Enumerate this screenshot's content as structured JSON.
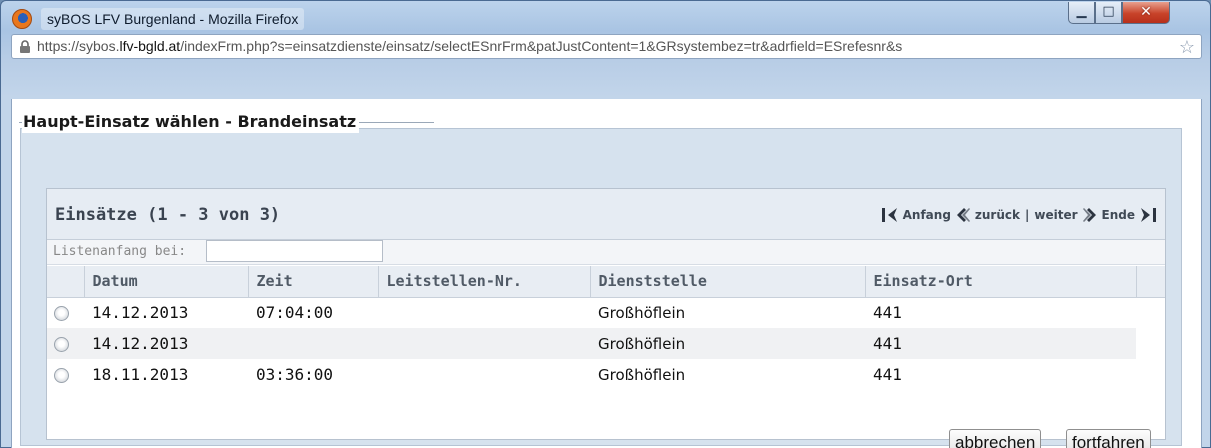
{
  "window": {
    "title": "syBOS LFV Burgenland - Mozilla Firefox",
    "controls": {
      "minimize": "▁",
      "maximize": "□",
      "close": "✕"
    }
  },
  "address_bar": {
    "url_prefix": "https://sybos.",
    "url_domain": "lfv-bgld.at",
    "url_path": "/indexFrm.php?s=einsatzdienste/einsatz/selectESnrFrm&patJustContent=1&GRsystembez=tr&adrfield=ESrefesnr&s"
  },
  "dialog": {
    "title": "Haupt-Einsatz wählen - Brandeinsatz"
  },
  "list": {
    "title": "Einsätze (1 - 3 von 3)",
    "pager": {
      "first": "Anfang",
      "prev": "zurück",
      "separator": "|",
      "next": "weiter",
      "last": "Ende"
    },
    "start_label": "Listenanfang bei:",
    "start_value": "",
    "columns": [
      "Datum",
      "Zeit",
      "Leitstellen-Nr.",
      "Dienststelle",
      "Einsatz-Ort"
    ],
    "rows": [
      {
        "datum": "14.12.2013",
        "zeit": "07:04:00",
        "leitstelle": "",
        "dienststelle": "Großhöflein",
        "ort": "441"
      },
      {
        "datum": "14.12.2013",
        "zeit": "",
        "leitstelle": "",
        "dienststelle": "Großhöflein",
        "ort": "441"
      },
      {
        "datum": "18.11.2013",
        "zeit": "03:36:00",
        "leitstelle": "",
        "dienststelle": "Großhöflein",
        "ort": "441"
      }
    ]
  },
  "buttons": {
    "cancel": "abbrechen",
    "continue": "fortfahren"
  }
}
